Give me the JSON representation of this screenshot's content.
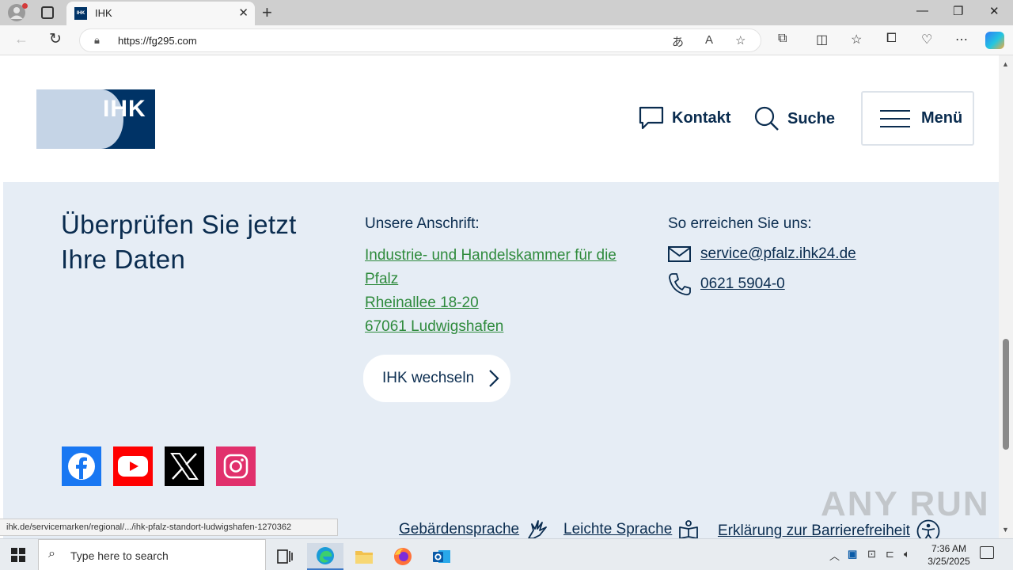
{
  "browser": {
    "tab_title": "IHK",
    "tab_favicon": "IHK",
    "url": "https://fg295.com",
    "status_url": "ihk.de/servicemarken/regional/.../ihk-pfalz-standort-ludwigshafen-1270362"
  },
  "header": {
    "logo_text": "IHK",
    "contact_label": "Kontakt",
    "search_label": "Suche",
    "menu_label": "Menü"
  },
  "footer": {
    "heading_line1": "Überprüfen Sie jetzt",
    "heading_line2": "Ihre Daten",
    "address_title": "Unsere Anschrift:",
    "address_lines": [
      "Industrie- und Handelskammer für die",
      "Pfalz",
      "Rheinallee 18-20",
      "67061 Ludwigshafen"
    ],
    "contact_title": "So erreichen Sie uns:",
    "email": "service@pfalz.ihk24.de",
    "phone": "0621 5904-0",
    "switch_button": "IHK wechseln",
    "bottom_links": [
      "Gebärdensprache",
      "Leichte Sprache",
      "Erklärung zur Barrierefreiheit"
    ]
  },
  "social_icons": [
    "facebook-icon",
    "youtube-icon",
    "x-icon",
    "instagram-icon"
  ],
  "colors": {
    "ihk_blue": "#003366",
    "footer_bg": "#e6edf5",
    "link_green": "#2e8a3c",
    "facebook": "#1877f2",
    "youtube": "#ff0000",
    "x": "#000000",
    "instagram": "#e1306c"
  },
  "watermark": "ANY RUN",
  "taskbar": {
    "search_placeholder": "Type here to search",
    "time": "7:36 AM",
    "date": "3/25/2025"
  }
}
